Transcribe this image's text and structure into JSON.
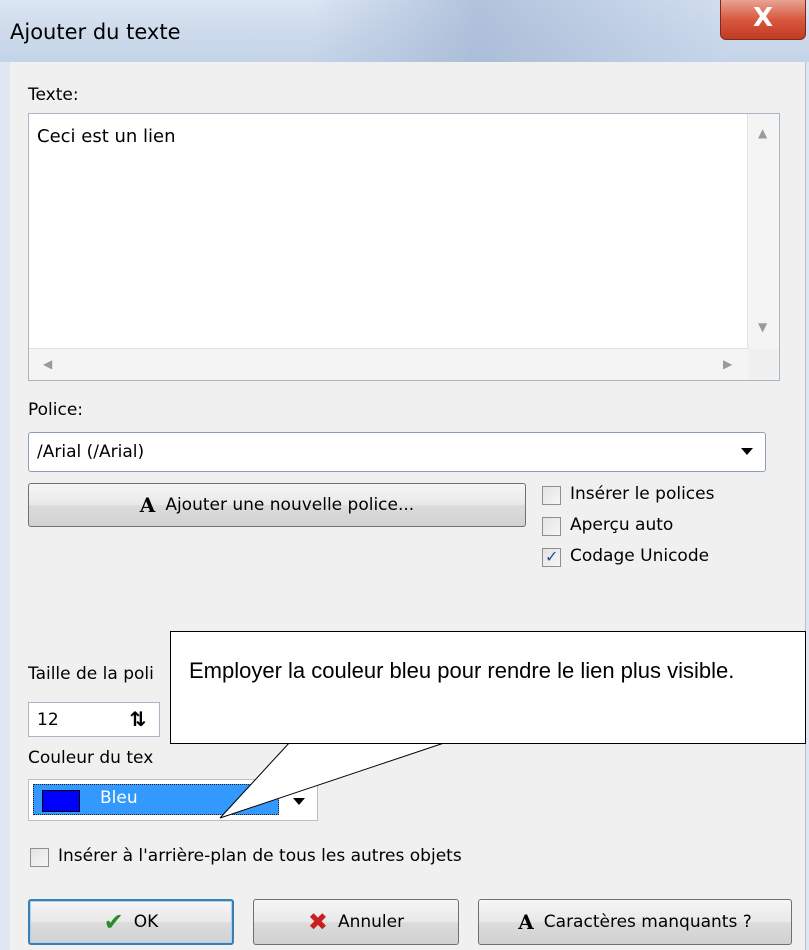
{
  "window": {
    "title": "Ajouter du texte",
    "close_symbol": "X"
  },
  "text_section": {
    "label": "Texte:",
    "value": "Ceci est un lien"
  },
  "font_section": {
    "label": "Police:",
    "selected": "/Arial (/Arial)",
    "add_font_button": "Ajouter une nouvelle police...",
    "options": [
      {
        "label": "Insérer le polices",
        "checked": false
      },
      {
        "label": "Aperçu auto",
        "checked": false
      },
      {
        "label": "Codage Unicode",
        "checked": true
      }
    ]
  },
  "size_section": {
    "label": "Taille de la poli",
    "value": "12"
  },
  "color_section": {
    "label": "Couleur du tex",
    "selected": "Bleu",
    "swatch": "#0000ff"
  },
  "background_checkbox": {
    "label": "Insérer à l'arrière-plan de tous les autres objets",
    "checked": false
  },
  "buttons": {
    "ok": "OK",
    "cancel": "Annuler",
    "missing_chars": "Caractères manquants ?"
  },
  "callout": {
    "text": "Employer la couleur bleu pour rendre le lien plus visible."
  }
}
